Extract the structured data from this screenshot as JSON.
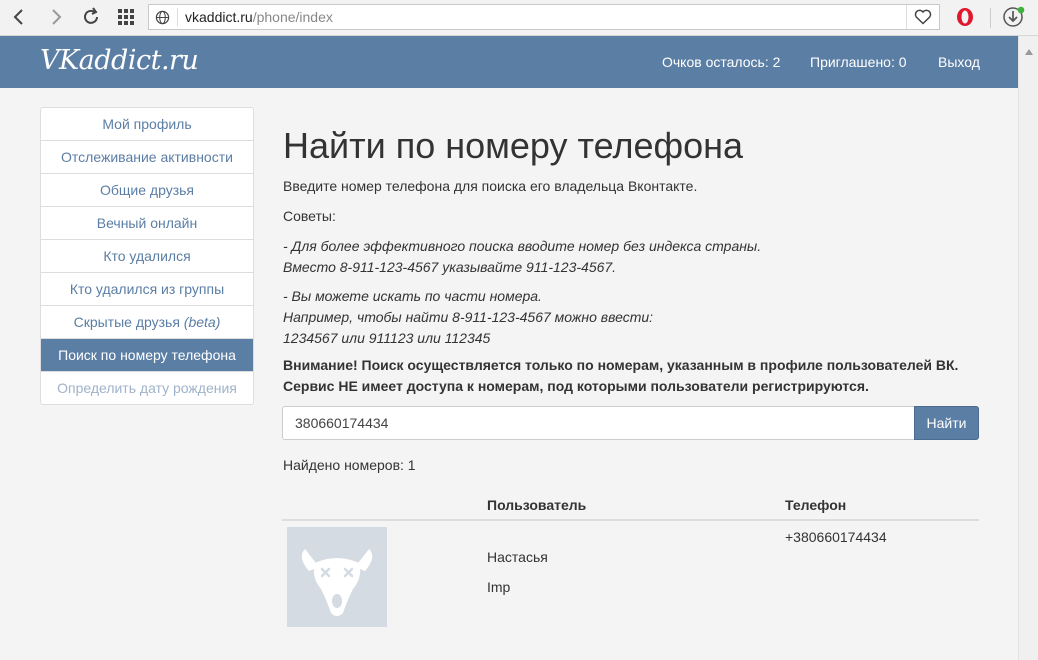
{
  "browser": {
    "url_host": "vkaddict.ru",
    "url_path": "/phone/index"
  },
  "header": {
    "logo": "VKaddict.ru",
    "points_left": "Очков осталось: 2",
    "invited": "Приглашено: 0",
    "logout": "Выход"
  },
  "sidebar": {
    "items": [
      {
        "label": "Мой профиль"
      },
      {
        "label": "Отслеживание активности"
      },
      {
        "label": "Общие друзья"
      },
      {
        "label": "Вечный онлайн"
      },
      {
        "label": "Кто удалился"
      },
      {
        "label": "Кто удалился из группы"
      },
      {
        "label": "Скрытые друзья",
        "suffix": "(beta)"
      },
      {
        "label": "Поиск по номеру телефона"
      },
      {
        "label": "Определить дату рождения"
      }
    ]
  },
  "main": {
    "title": "Найти по номеру телефона",
    "intro": "Введите номер телефона для поиска его владельца Вконтакте.",
    "tips_label": "Советы:",
    "tip1_line1": "- Для более эффективного поиска вводите номер без индекса страны.",
    "tip1_line2": "Вместо 8-911-123-4567 указывайте 911-123-4567.",
    "tip2_line1": "- Вы можете искать по части номера.",
    "tip2_line2": "Например, чтобы найти 8-911-123-4567 можно ввести:",
    "tip2_line3": "1234567 или 911123 или 112345",
    "warning_line1": "Внимание! Поиск осуществляется только по номерам, указанным в профиле пользователей ВК.",
    "warning_line2": "Сервис НЕ имеет доступа к номерам, под которыми пользователи регистрируются.",
    "search_value": "380660174434",
    "search_button": "Найти",
    "found_text": "Найдено номеров: 1",
    "table": {
      "col_user": "Пользователь",
      "col_phone": "Телефон",
      "rows": [
        {
          "first_name": "Настасья",
          "last_name": "Imp",
          "phone": "+380660174434"
        }
      ]
    }
  },
  "colors": {
    "brand": "#5b7ea5",
    "background": "#f4f4f4"
  }
}
